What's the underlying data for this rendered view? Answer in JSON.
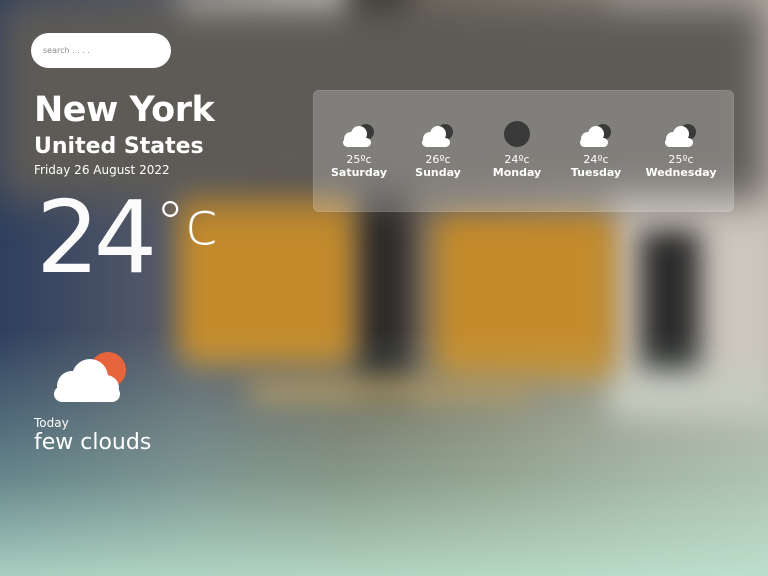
{
  "search": {
    "placeholder": "search . . . ."
  },
  "location": {
    "city": "New York",
    "country": "United States",
    "date": "Friday 26 August 2022"
  },
  "current": {
    "temp": "24",
    "unit": "°c",
    "label": "Today",
    "description": "few clouds",
    "icon": "cloud-sun-icon"
  },
  "forecast": [
    {
      "temp": "25ºc",
      "day": "Saturday",
      "icon": "cloud-icon"
    },
    {
      "temp": "26ºc",
      "day": "Sunday",
      "icon": "cloud-icon"
    },
    {
      "temp": "24ºc",
      "day": "Monday",
      "icon": "overcast-icon"
    },
    {
      "temp": "24ºc",
      "day": "Tuesday",
      "icon": "cloud-icon"
    },
    {
      "temp": "25ºc",
      "day": "Wednesday",
      "icon": "cloud-icon"
    }
  ],
  "colors": {
    "sun": "#e8643c",
    "cloud": "#ffffff",
    "dark_cloud": "#3a3a3a"
  }
}
